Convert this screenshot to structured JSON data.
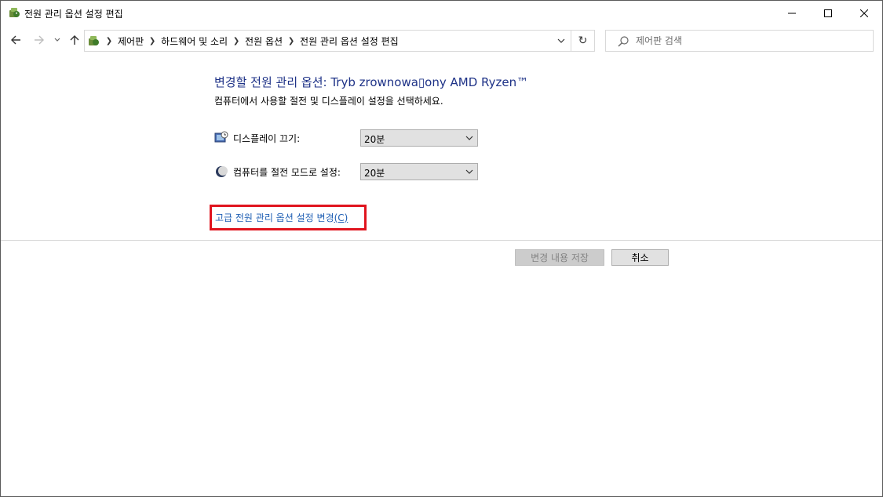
{
  "window": {
    "title": "전원 관리 옵션 설정 편집",
    "icon": "power-options-icon"
  },
  "controls": {
    "minimize_icon": "minimize-icon",
    "maximize_icon": "maximize-icon",
    "close_icon": "close-icon"
  },
  "nav": {
    "back_icon": "arrow-left-icon",
    "forward_icon": "arrow-right-icon",
    "recent_icon": "chevron-down-icon",
    "up_icon": "arrow-up-icon"
  },
  "address": {
    "breadcrumbs": [
      "제어판",
      "하드웨어 및 소리",
      "전원 옵션",
      "전원 관리 옵션 설정 편집"
    ],
    "refresh_glyph": "↻"
  },
  "search": {
    "placeholder": "제어판 검색"
  },
  "main": {
    "heading": "변경할 전원 관리 옵션: Tryb zrownowa▯ony AMD Ryzen™",
    "subtext": "컴퓨터에서 사용할 절전 및 디스플레이 설정을 선택하세요.",
    "display_off": {
      "label": "디스플레이 끄기:",
      "value": "20분"
    },
    "sleep": {
      "label": "컴퓨터를 절전 모드로 설정:",
      "value": "20분"
    },
    "advanced_link": "고급 전원 관리 옵션 설정 변경",
    "advanced_link_accel": "(C)"
  },
  "footer": {
    "save_label": "변경 내용 저장",
    "cancel_label": "취소"
  },
  "colors": {
    "heading": "#1e3287",
    "link": "#1f5fb4",
    "highlight_box": "#e0141e"
  }
}
